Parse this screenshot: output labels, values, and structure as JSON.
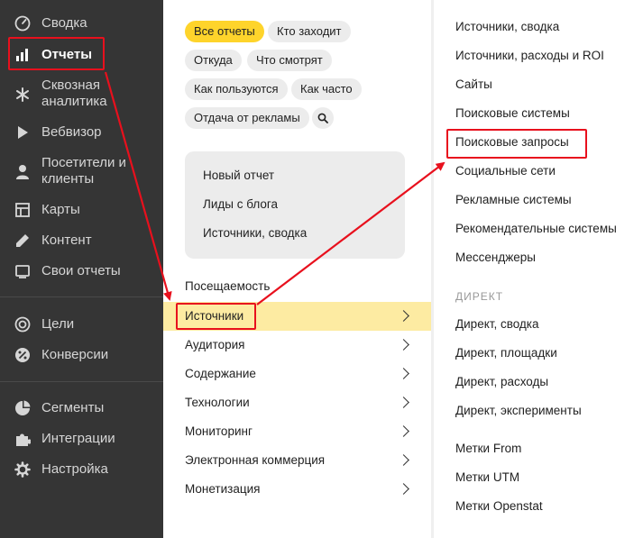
{
  "sidebar": {
    "items": [
      {
        "label": "Сводка",
        "icon": "gauge-icon"
      },
      {
        "label": "Отчеты",
        "icon": "bar-chart-icon",
        "active": true
      },
      {
        "label": "Сквозная аналитика",
        "icon": "asterisk-icon"
      },
      {
        "label": "Вебвизор",
        "icon": "play-icon"
      },
      {
        "label": "Посетители и клиенты",
        "icon": "person-icon"
      },
      {
        "label": "Карты",
        "icon": "map-grid-icon"
      },
      {
        "label": "Контент",
        "icon": "pencil-icon"
      },
      {
        "label": "Свои отчеты",
        "icon": "monitor-icon"
      },
      {
        "label": "Цели",
        "icon": "target-icon"
      },
      {
        "label": "Конверсии",
        "icon": "percent-icon"
      },
      {
        "label": "Сегменты",
        "icon": "pie-icon"
      },
      {
        "label": "Интеграции",
        "icon": "puzzle-icon"
      },
      {
        "label": "Настройка",
        "icon": "gear-icon"
      }
    ]
  },
  "chips": [
    "Все отчеты",
    "Кто заходит",
    "Откуда",
    "Что смотрят",
    "Как пользуются",
    "Как часто",
    "Отдача от рекламы"
  ],
  "favorites": [
    "Новый отчет",
    "Лиды с блога",
    "Источники, сводка"
  ],
  "menu": [
    "Посещаемость",
    "Источники",
    "Аудитория",
    "Содержание",
    "Технологии",
    "Мониторинг",
    "Электронная коммерция",
    "Монетизация"
  ],
  "sources": {
    "items": [
      "Источники, сводка",
      "Источники, расходы и ROI",
      "Сайты",
      "Поисковые системы",
      "Поисковые запросы",
      "Социальные сети",
      "Рекламные системы",
      "Рекомендательные системы",
      "Мессенджеры"
    ],
    "direct_heading": "ДИРЕКТ",
    "direct_items": [
      "Директ, сводка",
      "Директ, площадки",
      "Директ, расходы",
      "Директ, эксперименты"
    ],
    "tag_items": [
      "Метки From",
      "Метки UTM",
      "Метки Openstat"
    ]
  },
  "colors": {
    "sidebar_bg": "#353535",
    "accent_yellow": "#fed42b",
    "selected_row": "#fdeba2",
    "annotation_red": "#e8101d"
  }
}
